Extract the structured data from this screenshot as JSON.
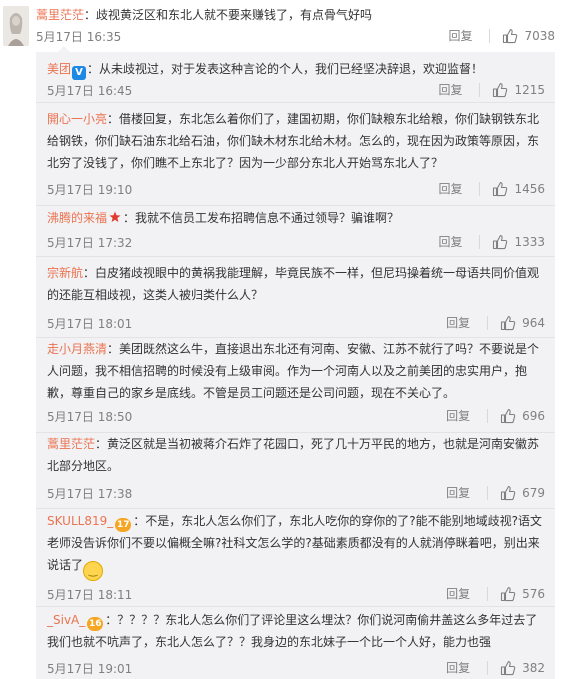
{
  "top_comment": {
    "user": "蒿里茫茫",
    "text": "：歧视黄泛区和东北人就不要来赚钱了，有点骨气好吗",
    "time": "5月17日 16:35",
    "reply_label": "回复",
    "likes": "7038"
  },
  "replies": [
    {
      "user": "美团",
      "verified_icon": "V",
      "text": "：从未歧视过，对于发表这种言论的个人，我们已经坚决辞退，欢迎监督！",
      "time": "5月17日 16:45",
      "reply_label": "回复",
      "likes": "1215"
    },
    {
      "user": "開心一小亮",
      "text": "：借楼回复，东北怎么着你们了，建国初期，你们缺粮东北给粮，你们缺钢铁东北给钢铁，你们缺石油东北给石油，你们缺木材东北给木材。怎么的，现在因为政策等原因，东北穷了没钱了，你们瞧不上东北了？因为一少部分东北人开始骂东北人了？",
      "time": "5月17日 19:10",
      "reply_label": "回复",
      "likes": "1456"
    },
    {
      "user": "沸腾的来福",
      "text": "：我就不信员工发布招聘信息不通过领导？骗谁啊？",
      "time": "5月17日 17:32",
      "reply_label": "回复",
      "likes": "1333"
    },
    {
      "user": "宗新航",
      "text": "：白皮猪歧视眼中的黄祸我能理解，毕竟民族不一样，但尼玛操着统一母语共同价值观的还能互相歧视，这类人被归类什么人？",
      "time": "5月17日 18:01",
      "reply_label": "回复",
      "likes": "964"
    },
    {
      "user": "走小月燕清",
      "text": "：美团既然这么牛，直接退出东北还有河南、安徽、江苏不就行了吗？不要说是个人问题，我不相信招聘的时候没有上级审阅。作为一个河南人以及之前美团的忠实用户，抱歉，尊重自己的家乡是底线。不管是员工问题还是公司问题，现在不关心了。",
      "time": "5月17日 18:50",
      "reply_label": "回复",
      "likes": "696"
    },
    {
      "user": "蒿里茫茫",
      "text": "：黄泛区就是当初被蒋介石炸了花园口，死了几十万平民的地方，也就是河南安徽苏北部分地区。",
      "time": "5月17日 17:38",
      "reply_label": "回复",
      "likes": "679"
    },
    {
      "user": "SKULL819_",
      "level": "17",
      "text": "：不是，东北人怎么你们了，东北人吃你的穿你的了?能不能别地域歧视?语文老师没告诉你们不要以偏概全嘛?社科文怎么学的?基础素质都没有的人就消停眯着吧，别出来说话了",
      "time": "5月17日 18:11",
      "reply_label": "回复",
      "likes": "576"
    },
    {
      "user": "_SivA_",
      "level": "16",
      "text": "：？？？？东北人怎么你们了评论里这么埋汰？你们说河南偷井盖这么多年过去了我们也就不吭声了，东北人怎么了？？我身边的东北妹子一个比一个人好，能力也强",
      "time": "5月17日 19:01",
      "reply_label": "回复",
      "likes": "382"
    }
  ]
}
